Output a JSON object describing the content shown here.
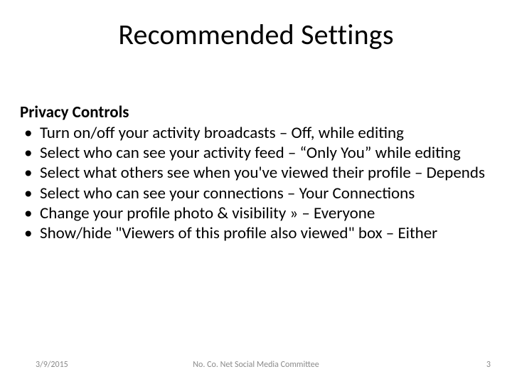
{
  "title": "Recommended Settings",
  "section_heading": "Privacy Controls",
  "bullets": [
    "Turn on/off your activity broadcasts – Off, while editing",
    "Select who can see your activity feed – “Only You” while editing",
    "Select what others see when you've viewed their profile – Depends",
    "Select who can see your connections – Your Connections",
    "Change your profile photo & visibility » – Everyone",
    "Show/hide \"Viewers of this profile also viewed\" box – Either"
  ],
  "footer": {
    "date": "3/9/2015",
    "center": "No. Co. Net Social Media Committee",
    "page": "3"
  }
}
